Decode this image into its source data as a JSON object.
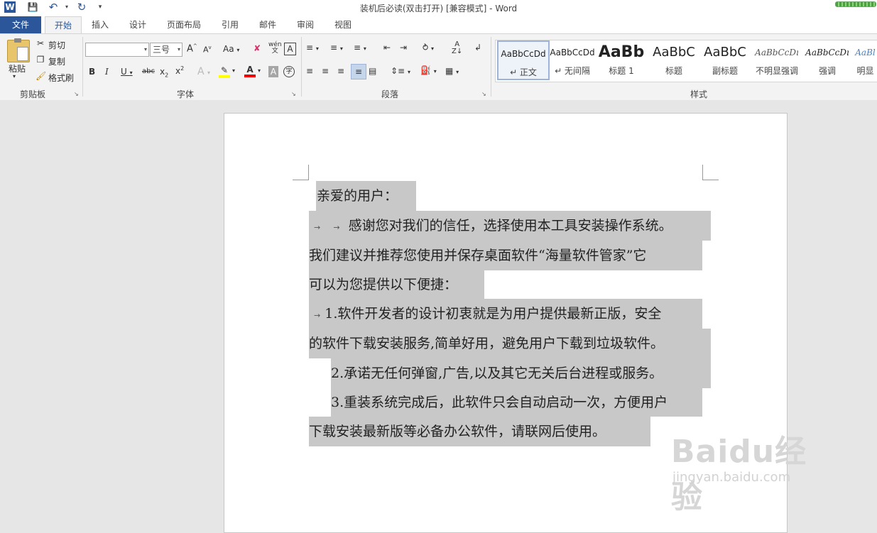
{
  "window": {
    "title": "装机后必读(双击打开) [兼容模式] - Word"
  },
  "tabs": {
    "file": "文件",
    "home": "开始",
    "insert": "插入",
    "design": "设计",
    "layout": "页面布局",
    "references": "引用",
    "mailings": "邮件",
    "review": "审阅",
    "view": "视图"
  },
  "clipboard": {
    "paste": "粘贴",
    "cut": "剪切",
    "copy": "复制",
    "format_painter": "格式刷",
    "label": "剪贴板"
  },
  "font": {
    "name_value": "",
    "size_value": "三号",
    "label": "字体",
    "change_case": "Aa"
  },
  "paragraph": {
    "label": "段落"
  },
  "styles": {
    "label": "样式",
    "items": [
      {
        "sample": "AaBbCcDd",
        "name": "↵ 正文"
      },
      {
        "sample": "AaBbCcDd",
        "name": "↵ 无间隔"
      },
      {
        "sample": "AaBb",
        "name": "标题 1"
      },
      {
        "sample": "AaBbC",
        "name": "标题"
      },
      {
        "sample": "AaBbC",
        "name": "副标题"
      },
      {
        "sample": "AaBbCcDı",
        "name": "不明显强调"
      },
      {
        "sample": "AaBbCcDı",
        "name": "强调"
      },
      {
        "sample": "AaBl",
        "name": "明显"
      }
    ]
  },
  "document": {
    "greeting": "亲爱的用户：",
    "line1": "感谢您对我们的信任，选择使用本工具安装操作系统。",
    "line2": "我们建议并推荐您使用并保存桌面软件“海量软件管家”它",
    "line3": "可以为您提供以下便捷：",
    "line4": "1.软件开发者的设计初衷就是为用户提供最新正版，安全",
    "line5": "的软件下载安装服务,简单好用，避免用户下载到垃圾软件。",
    "line6": "2.承诺无任何弹窗,广告,以及其它无关后台进程或服务。",
    "line7": "3.重装系统完成后，此软件只会自动启动一次，方便用户",
    "line8": "下载安装最新版等必备办公软件，请联网后使用。"
  },
  "watermark": {
    "brand": "Baidu经验",
    "url": "jingyan.baidu.com"
  }
}
